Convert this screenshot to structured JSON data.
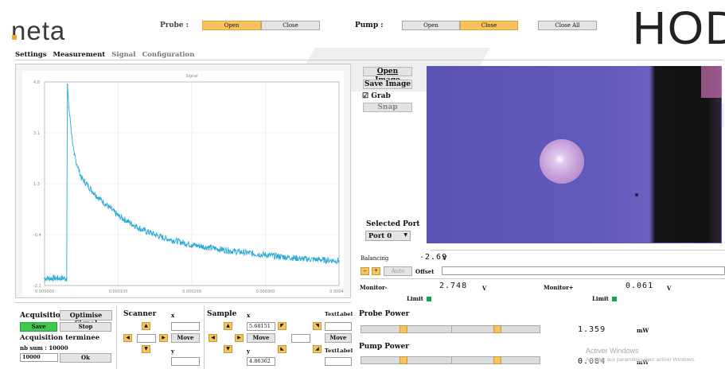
{
  "brand": {
    "logo_text": "neta",
    "right_text": "HOD"
  },
  "probe": {
    "label": "Probe :",
    "open": "Open",
    "close": "Close"
  },
  "pump": {
    "label": "Pump :",
    "open": "Open",
    "close": "Close",
    "close_all": "Close All"
  },
  "tabs": [
    "Settings",
    "Measurement",
    "Signal",
    "Configuration"
  ],
  "active_tab": "Measurement",
  "chart_data": {
    "type": "line",
    "title": "Signal",
    "y_ticks": [
      "4.8",
      "3.1",
      "1.3",
      "-0.4",
      "-2.2"
    ],
    "x_ticks": [
      "0.000000",
      "0.000100",
      "0.000200",
      "0.000300",
      "0.000400"
    ],
    "xlim": [
      0,
      0.0004
    ],
    "ylim": [
      -2.2,
      4.8
    ],
    "grid": true,
    "color": "#2aa8d8",
    "series": [
      {
        "x": [
          0,
          3e-05,
          3.1e-05,
          3.3e-05,
          4e-05,
          5e-05,
          7e-05,
          0.0001,
          0.00013,
          0.00016,
          0.0002,
          0.00025,
          0.0003,
          0.00035,
          0.0004
        ],
        "values": [
          -1.95,
          -1.95,
          4.7,
          3.9,
          2.3,
          1.5,
          0.9,
          0.2,
          -0.25,
          -0.55,
          -0.8,
          -1.0,
          -1.15,
          -1.28,
          -1.35
        ]
      }
    ]
  },
  "image_panel": {
    "open": "Open Image",
    "save": "Save Image",
    "grab": "Grab",
    "snap": "Snap",
    "selected_port_label": "Selected Port",
    "port_value": "Port 0"
  },
  "balancing": {
    "label": "Balancing",
    "value": "-2.69",
    "unit": "V",
    "auto": "Auto",
    "offset": "Offset"
  },
  "monitor": {
    "minus_label": "Monitor-",
    "minus_value": "2.748",
    "minus_unit": "V",
    "plus_label": "Monitor+",
    "plus_value": "0.061",
    "plus_unit": "V",
    "limit": "Limit"
  },
  "acquisition": {
    "title": "Acquisition",
    "optimise": "Optimise Signal",
    "save": "Save",
    "stop": "Stop",
    "status": "Acquisition terminee",
    "nb_sum": "nb sum : 10000",
    "sum_value": "10000",
    "ok": "Ok"
  },
  "scanner": {
    "title": "Scanner",
    "x": "x",
    "y": "y",
    "move": "Move"
  },
  "sample": {
    "title": "Sample",
    "x": "x",
    "y": "y",
    "x_value": "5.68151",
    "y_value": "4.86362",
    "move": "Move",
    "textlabel_1": "TextLabel",
    "textlabel_2": "TextLabel",
    "move_2": "Move"
  },
  "power": {
    "probe_label": "Probe Power",
    "probe_value": "1.359",
    "probe_unit": "mW",
    "pump_label": "Pump Power",
    "pump_value": "0.084",
    "pump_unit": "mW"
  },
  "windows_watermark": {
    "line1": "Activer Windows",
    "line2": "Accédez aux paramètres pour activer Windows."
  }
}
